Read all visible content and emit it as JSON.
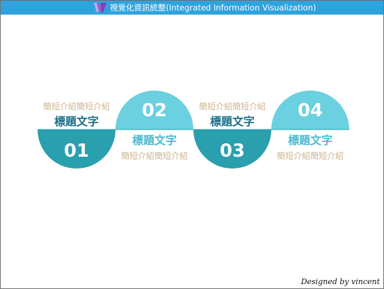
{
  "window": {
    "title": "視覺化資訊統整(Integrated Information Visualization)"
  },
  "diagram": {
    "steps": [
      {
        "number": "01",
        "heading": "標題文字",
        "description": "簡短介紹簡短介紹"
      },
      {
        "number": "02",
        "heading": "標題文字",
        "description": "簡短介紹簡短介紹"
      },
      {
        "number": "03",
        "heading": "標題文字",
        "description": "簡短介紹簡短介紹"
      },
      {
        "number": "04",
        "heading": "標題文字",
        "description": "簡短介紹簡短介紹"
      }
    ]
  },
  "footer": {
    "credit": "Designed by vincent"
  },
  "colors": {
    "titlebar": "#2fa3dd",
    "dark_teal": "#2a9fae",
    "light_teal": "#6bd0df",
    "description_text": "#cdb48f",
    "heading_dark": "#1b6e86",
    "heading_light": "#4cb9cf"
  }
}
